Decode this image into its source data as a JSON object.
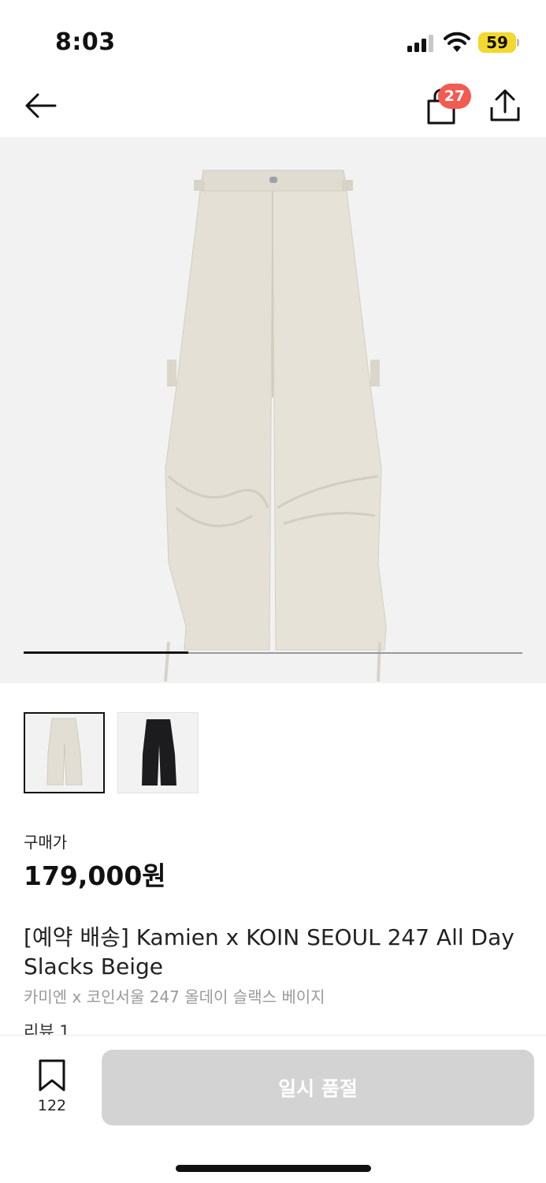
{
  "status": {
    "time": "8:03",
    "battery": "59",
    "signal_icon": "cellular-signal-icon",
    "wifi_icon": "wifi-icon"
  },
  "nav": {
    "back_icon": "arrow-left-icon",
    "cart_icon": "shopping-bag-icon",
    "cart_count": "27",
    "share_icon": "share-upload-icon"
  },
  "gallery": {
    "progress_fraction": 0.33,
    "thumbnails": [
      {
        "color": "beige",
        "selected": true
      },
      {
        "color": "black",
        "selected": false
      }
    ]
  },
  "product": {
    "price_label": "구매가",
    "price": "179,000원",
    "title": "[예약 배송] Kamien x KOIN SEOUL 247 All Day Slacks Beige",
    "subtitle": "카미엔 x 코인서울 247 올데이 슬랙스 베이지",
    "review": "리뷰 1"
  },
  "bottom_bar": {
    "bookmark_icon": "bookmark-icon",
    "bookmark_count": "122",
    "soldout_label": "일시 품절"
  },
  "colors": {
    "badge": "#f25a52",
    "battery": "#f3d82f",
    "disabled_button": "#d3d3d3",
    "image_background": "#f2f2f2",
    "pants_beige": "#e2ded3",
    "pants_black": "#1c1c1e"
  }
}
